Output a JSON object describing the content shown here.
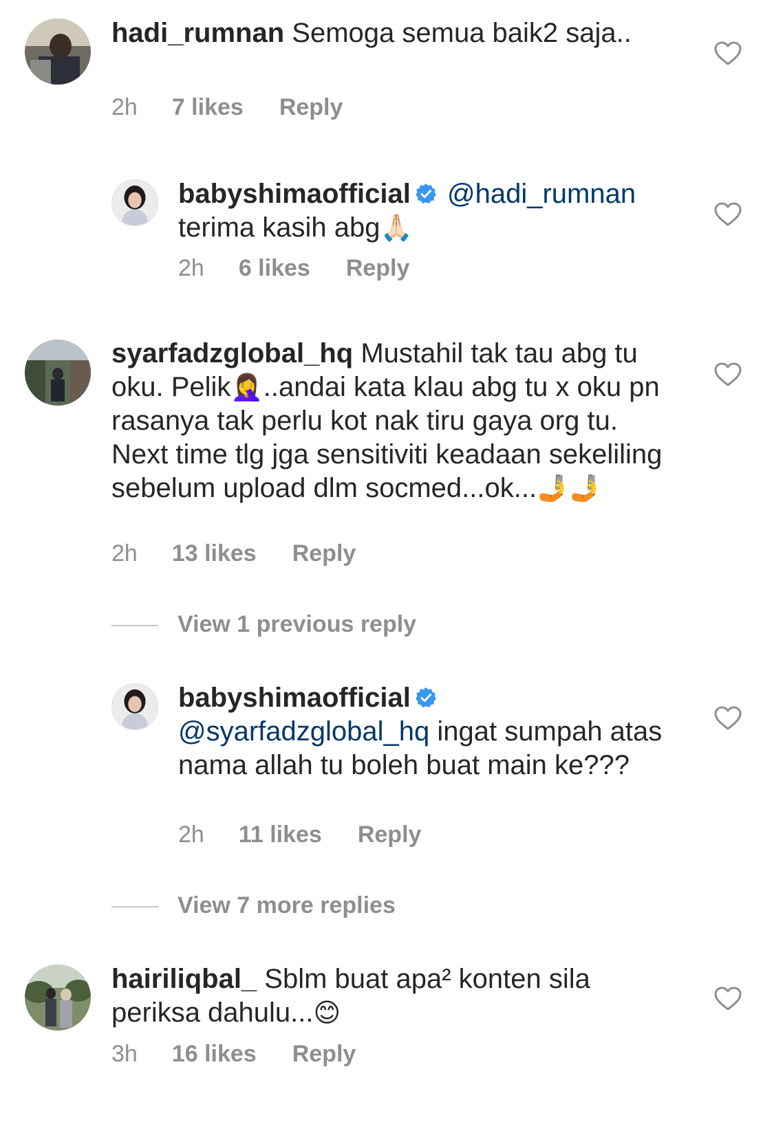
{
  "comments": [
    {
      "username": "hadi_rumnan",
      "text": "Semoga semua baik2 saja..",
      "time": "2h",
      "likes": "7 likes",
      "reply_label": "Reply"
    },
    {
      "username": "babyshimaofficial",
      "mention": "@hadi_rumnan",
      "text": "terima kasih abg",
      "emoji": "🙏🏻",
      "time": "2h",
      "likes": "6 likes",
      "reply_label": "Reply"
    },
    {
      "username": "syarfadzglobal_hq",
      "text_part1": "Mustahil tak tau abg tu oku. Pelik",
      "emoji1": "🤦‍♀️",
      "text_part2": "..andai kata klau abg tu x oku pn rasanya tak perlu kot nak tiru gaya org tu. Next time tlg jga sensitiviti keadaan sekeliling sebelum upload dlm socmed...ok...",
      "emoji2": "🤳🤳",
      "time": "2h",
      "likes": "13 likes",
      "reply_label": "Reply"
    },
    {
      "username": "babyshimaofficial",
      "mention": "@syarfadzglobal_hq",
      "text": "ingat sumpah atas nama allah tu boleh buat main ke???",
      "time": "2h",
      "likes": "11 likes",
      "reply_label": "Reply"
    },
    {
      "username": "hairiliqbal_",
      "text": "Sblm buat apa² konten sila periksa dahulu...",
      "emoji": "😊",
      "time": "3h",
      "likes": "16 likes",
      "reply_label": "Reply"
    }
  ],
  "view_previous_replies": "View 1 previous reply",
  "view_more_replies": "View 7 more replies",
  "colors": {
    "text": "#262626",
    "secondary": "#8e8e8e",
    "mention": "#00376b",
    "verified": "#3897f0"
  },
  "icons": [
    "heart-outline-icon",
    "verified-badge-icon"
  ]
}
